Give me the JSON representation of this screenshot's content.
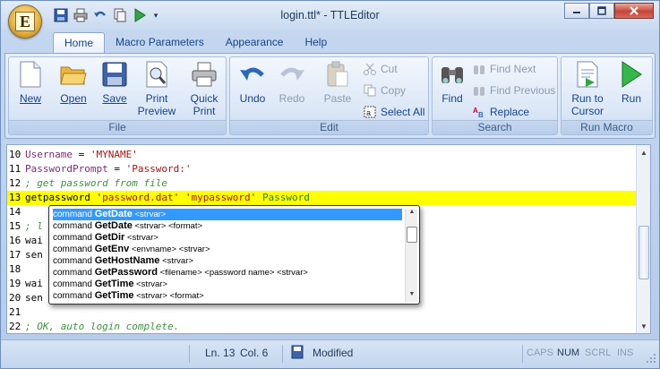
{
  "window": {
    "title": "login.ttl* - TTLEditor",
    "app_button_letter": "E"
  },
  "tabs": [
    {
      "label": "Home",
      "active": true
    },
    {
      "label": "Macro Parameters"
    },
    {
      "label": "Appearance"
    },
    {
      "label": "Help"
    }
  ],
  "ribbon": {
    "file": {
      "title": "File",
      "new": "New",
      "open": "Open",
      "save": "Save",
      "print_preview_1": "Print",
      "print_preview_2": "Preview",
      "quick_print_1": "Quick",
      "quick_print_2": "Print"
    },
    "edit": {
      "title": "Edit",
      "undo": "Undo",
      "redo": "Redo",
      "paste": "Paste",
      "cut": "Cut",
      "copy": "Copy",
      "select_all": "Select All"
    },
    "search": {
      "title": "Search",
      "find": "Find",
      "find_next": "Find Next",
      "find_previous": "Find Previous",
      "replace": "Replace"
    },
    "run": {
      "title": "Run Macro",
      "run_to_cursor_1": "Run to",
      "run_to_cursor_2": "Cursor",
      "run": "Run"
    }
  },
  "editor": {
    "lines": [
      {
        "no": "10",
        "parts": [
          [
            "id",
            "Username"
          ],
          [
            "kw",
            " = "
          ],
          [
            "str",
            "'MYNAME'"
          ]
        ]
      },
      {
        "no": "11",
        "parts": [
          [
            "id",
            "PasswordPrompt"
          ],
          [
            "kw",
            " = "
          ],
          [
            "str",
            "'Password:'"
          ]
        ]
      },
      {
        "no": "12",
        "parts": [
          [
            "cmt",
            "; get password from file"
          ]
        ]
      },
      {
        "no": "13",
        "parts": [
          [
            "kw",
            "getpassword "
          ],
          [
            "str",
            "'password.dat'"
          ],
          [
            "kw",
            " "
          ],
          [
            "str",
            "'mypassword'"
          ],
          [
            "kw",
            " "
          ],
          [
            "vb",
            "Password"
          ]
        ],
        "highlight": true
      },
      {
        "no": "14",
        "parts": []
      },
      {
        "no": "15",
        "parts": [
          [
            "cmt",
            "; l"
          ]
        ]
      },
      {
        "no": "16",
        "parts": [
          [
            "kw",
            "wai"
          ]
        ]
      },
      {
        "no": "17",
        "parts": [
          [
            "kw",
            "sen"
          ]
        ]
      },
      {
        "no": "18",
        "parts": []
      },
      {
        "no": "19",
        "parts": [
          [
            "kw",
            "wai"
          ]
        ]
      },
      {
        "no": "20",
        "parts": [
          [
            "kw",
            "sen"
          ]
        ]
      },
      {
        "no": "21",
        "parts": []
      },
      {
        "no": "22",
        "parts": [
          [
            "cmt",
            "; OK, auto login complete."
          ]
        ]
      }
    ]
  },
  "autocomplete": {
    "items": [
      {
        "prefix": "command ",
        "name": "GetDate",
        "args": " <strvar>",
        "selected": true
      },
      {
        "prefix": "command ",
        "name": "GetDate",
        "args": " <strvar> <format>"
      },
      {
        "prefix": "command ",
        "name": "GetDir",
        "args": " <strvar>"
      },
      {
        "prefix": "command ",
        "name": "GetEnv",
        "args": " <envname> <strvar>"
      },
      {
        "prefix": "command ",
        "name": "GetHostName",
        "args": " <strvar>"
      },
      {
        "prefix": "command ",
        "name": "GetPassword",
        "args": " <filename> <password name> <strvar>"
      },
      {
        "prefix": "command ",
        "name": "GetTime",
        "args": " <strvar>"
      },
      {
        "prefix": "command ",
        "name": "GetTime",
        "args": " <strvar> <format>"
      }
    ]
  },
  "status": {
    "line": "Ln. 13",
    "col": "Col. 6",
    "state": "Modified",
    "caps": "CAPS",
    "num": "NUM",
    "scrl": "SCRL",
    "ins": "INS"
  },
  "colors": {
    "highlight": "#ffff00",
    "selection": "#3399ff",
    "accent": "#15428b"
  }
}
